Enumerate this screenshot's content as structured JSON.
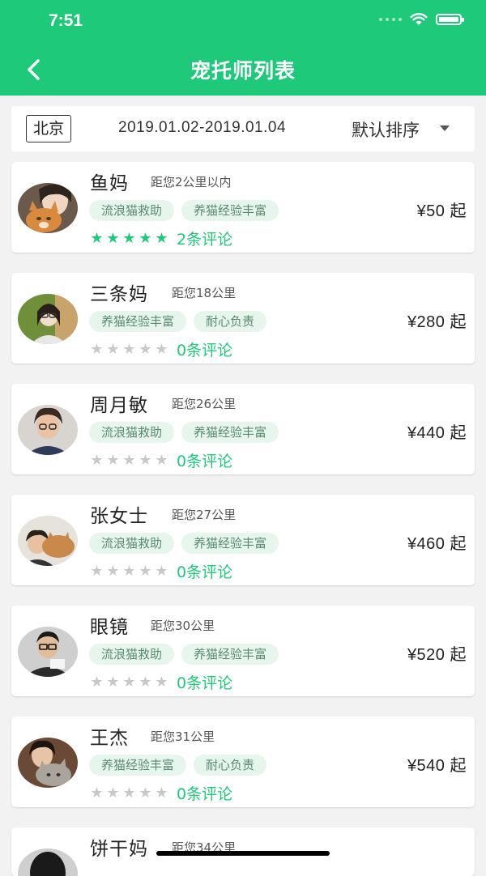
{
  "status_bar": {
    "time": "7:51"
  },
  "header": {
    "title": "宠托师列表"
  },
  "filter": {
    "city": "北京",
    "date_range": "2019.01.02-2019.01.04",
    "sort": "默认排序"
  },
  "colors": {
    "brand": "#1ec97a",
    "tag_bg": "#e6f6ec",
    "tag_text": "#5a8a6e",
    "star_off": "#c8c8c8"
  },
  "sitters": [
    {
      "name": "鱼妈",
      "distance": "距您2公里以内",
      "tags": [
        "流浪猫救助",
        "养猫经验丰富"
      ],
      "price": "¥50 起",
      "rating": 5,
      "reviews": "2条评论"
    },
    {
      "name": "三条妈",
      "distance": "距您18公里",
      "tags": [
        "养猫经验丰富",
        "耐心负责"
      ],
      "price": "¥280 起",
      "rating": 0,
      "reviews": "0条评论"
    },
    {
      "name": "周月敏",
      "distance": "距您26公里",
      "tags": [
        "流浪猫救助",
        "养猫经验丰富"
      ],
      "price": "¥440 起",
      "rating": 0,
      "reviews": "0条评论"
    },
    {
      "name": "张女士",
      "distance": "距您27公里",
      "tags": [
        "流浪猫救助",
        "养猫经验丰富"
      ],
      "price": "¥460 起",
      "rating": 0,
      "reviews": "0条评论"
    },
    {
      "name": "眼镜",
      "distance": "距您30公里",
      "tags": [
        "流浪猫救助",
        "养猫经验丰富"
      ],
      "price": "¥520 起",
      "rating": 0,
      "reviews": "0条评论"
    },
    {
      "name": "王杰",
      "distance": "距您31公里",
      "tags": [
        "养猫经验丰富",
        "耐心负责"
      ],
      "price": "¥540 起",
      "rating": 0,
      "reviews": "0条评论"
    },
    {
      "name": "饼干妈",
      "distance": "距您34公里",
      "tags": [],
      "price": "",
      "rating": 0,
      "reviews": ""
    }
  ]
}
